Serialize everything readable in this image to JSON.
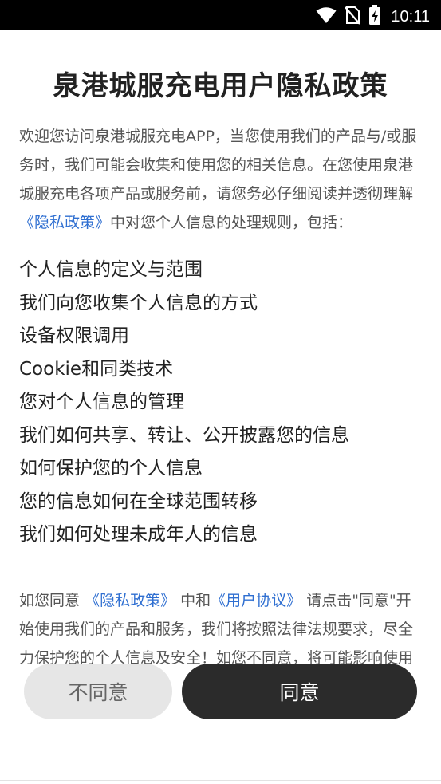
{
  "status_bar": {
    "time": "10:11",
    "icons": [
      "wifi-icon",
      "no-sim-icon",
      "battery-charging-icon"
    ]
  },
  "title": "泉港城服充电用户隐私政策",
  "intro": {
    "part1": "欢迎您访问泉港城服充电APP，当您使用我们的产品与/或服务时，我们可能会收集和使用您的相关信息。在您使用泉港城服充电各项产品或服务前，请您务必仔细阅读并透彻理解",
    "link": "《隐私政策》",
    "part2": "中对您个人信息的处理规则，包括："
  },
  "items": [
    "个人信息的定义与范围",
    "我们向您收集个人信息的方式",
    "设备权限调用",
    "Cookie和同类技术",
    "您对个人信息的管理",
    "我们如何共享、转让、公开披露您的信息",
    "如何保护您的个人信息",
    "您的信息如何在全球范围转移",
    "我们如何处理未成年人的信息"
  ],
  "consent": {
    "part1": "如您同意",
    "privacy_link": "《隐私政策》",
    "part2": "中和",
    "agreement_link": "《用户协议》",
    "part3": "请点击\"同意\"开始使用我们的产品和服务，我们将按照法律法规要求，尽全力保护您的个人信息及安全！如您不同意，将可能影响使用"
  },
  "buttons": {
    "disagree": "不同意",
    "agree": "同意"
  },
  "colors": {
    "link": "#2f6fd1",
    "agree_bg": "#2b2b2b",
    "disagree_bg": "#e6e6e6"
  }
}
